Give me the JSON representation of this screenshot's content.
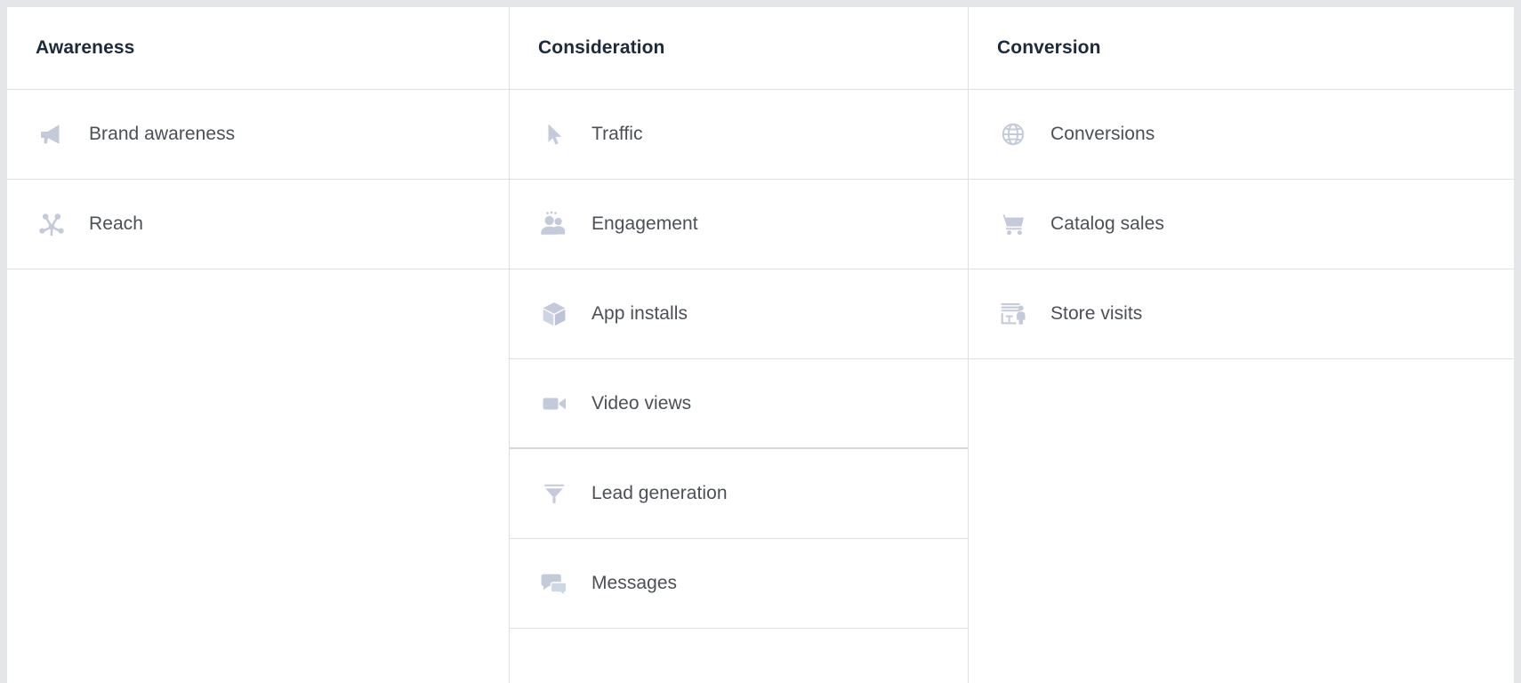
{
  "theme": {
    "page_background": "#e4e6e9",
    "card_background": "#ffffff",
    "border_color": "#dddfe2",
    "header_text_color": "#1c2b3c",
    "label_text_color": "#4b4f56",
    "icon_color": "#c3cbdb"
  },
  "columns": [
    {
      "key": "awareness",
      "header": "Awareness",
      "objectives": [
        {
          "label": "Brand awareness",
          "icon": "megaphone-icon"
        },
        {
          "label": "Reach",
          "icon": "reach-star-icon"
        }
      ]
    },
    {
      "key": "consideration",
      "header": "Consideration",
      "objectives": [
        {
          "label": "Traffic",
          "icon": "cursor-arrow-icon"
        },
        {
          "label": "Engagement",
          "icon": "people-group-icon"
        },
        {
          "label": "App installs",
          "icon": "cube-box-icon"
        },
        {
          "label": "Video views",
          "icon": "video-camera-icon"
        },
        {
          "label": "Lead generation",
          "icon": "funnel-icon"
        },
        {
          "label": "Messages",
          "icon": "chat-bubbles-icon"
        }
      ]
    },
    {
      "key": "conversion",
      "header": "Conversion",
      "objectives": [
        {
          "label": "Conversions",
          "icon": "globe-icon"
        },
        {
          "label": "Catalog sales",
          "icon": "shopping-cart-icon"
        },
        {
          "label": "Store visits",
          "icon": "storefront-icon"
        }
      ]
    }
  ]
}
